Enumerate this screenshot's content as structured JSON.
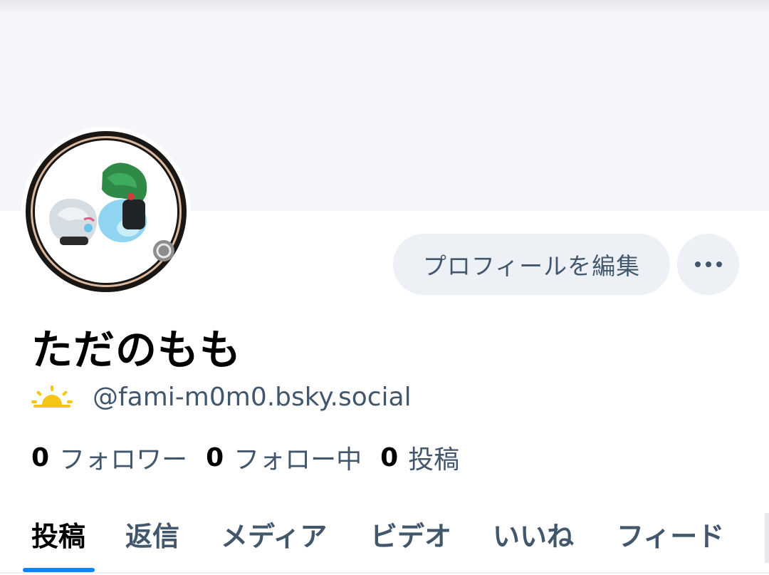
{
  "profile": {
    "display_name": "ただのもも",
    "handle": "@fami-m0m0.bsky.social"
  },
  "actions": {
    "edit_label": "プロフィールを編集",
    "more_icon": "ellipsis-icon"
  },
  "stats": [
    {
      "count": "0",
      "label": "フォロワー"
    },
    {
      "count": "0",
      "label": "フォロー中"
    },
    {
      "count": "0",
      "label": "投稿"
    }
  ],
  "tabs": [
    {
      "label": "投稿",
      "active": true
    },
    {
      "label": "返信"
    },
    {
      "label": "メディア"
    },
    {
      "label": "ビデオ"
    },
    {
      "label": "いいね"
    },
    {
      "label": "フィード"
    }
  ],
  "colors": {
    "accent": "#1083fe",
    "muted_text": "#42576c",
    "button_bg": "#edf1f6",
    "banner_bg": "#f5f6f9",
    "sun": "#f5c518"
  }
}
